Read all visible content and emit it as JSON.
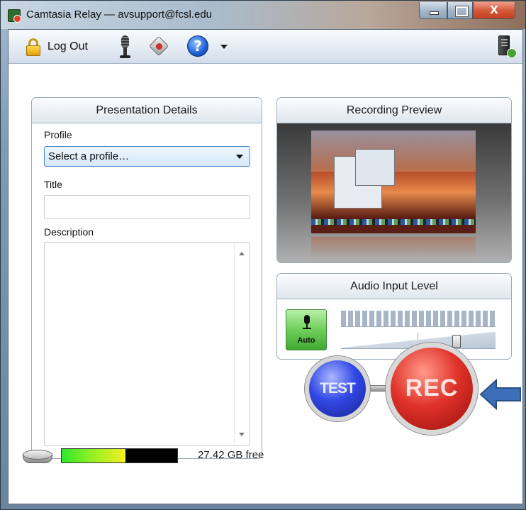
{
  "window": {
    "title": "Camtasia Relay — avsupport@fcsl.edu",
    "close_glyph": "X"
  },
  "toolbar": {
    "logout_label": "Log Out",
    "help_glyph": "?",
    "icons": [
      "lock-icon",
      "microphone-icon",
      "settings-icon",
      "help-icon",
      "chevron-down-icon",
      "server-status-icon"
    ]
  },
  "details": {
    "header": "Presentation Details",
    "profile_label": "Profile",
    "profile_value": "Select a profile…",
    "title_label": "Title",
    "title_value": "",
    "description_label": "Description",
    "description_value": ""
  },
  "preview": {
    "header": "Recording Preview"
  },
  "audio": {
    "header": "Audio Input Level",
    "auto_label": "Auto",
    "meter_segments": 24
  },
  "controls": {
    "test_label": "TEST",
    "rec_label": "REC"
  },
  "footer": {
    "disk_free": "27.42 GB free",
    "disk_used_fraction": 0.55
  },
  "colors": {
    "rec_red": "#e0322a",
    "test_blue": "#3348e6",
    "auto_green": "#6fce5a",
    "arrow_blue": "#3c6fb8"
  }
}
